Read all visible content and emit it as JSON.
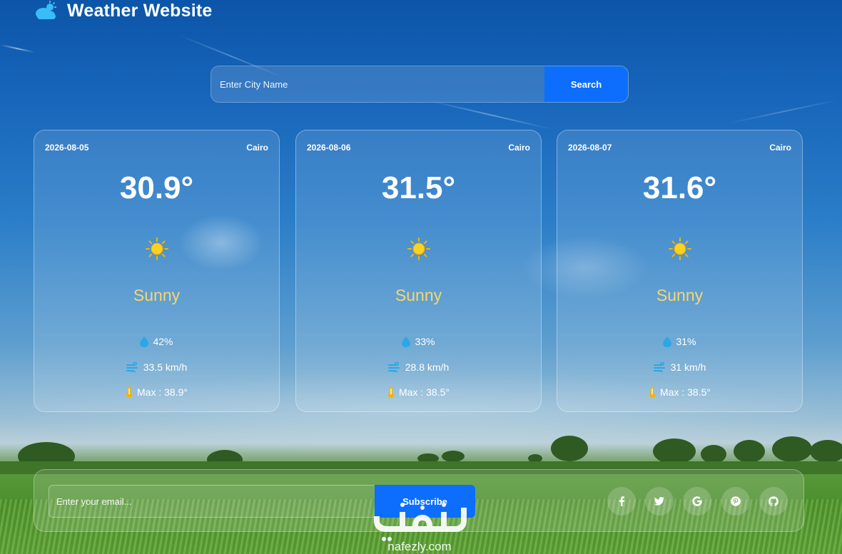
{
  "header": {
    "title": "Weather Website",
    "logo_icon": "cloud-sun-icon"
  },
  "search": {
    "placeholder": "Enter City Name",
    "button_label": "Search"
  },
  "forecast": [
    {
      "date": "2026-08-05",
      "city": "Cairo",
      "temp": "30.9°",
      "condition": "Sunny",
      "condition_icon": "sun-icon",
      "humidity": "42%",
      "wind": "33.5 km/h",
      "max": "Max : 38.9°"
    },
    {
      "date": "2026-08-06",
      "city": "Cairo",
      "temp": "31.5°",
      "condition": "Sunny",
      "condition_icon": "sun-icon",
      "humidity": "33%",
      "wind": "28.8 km/h",
      "max": "Max : 38.5°"
    },
    {
      "date": "2026-08-07",
      "city": "Cairo",
      "temp": "31.6°",
      "condition": "Sunny",
      "condition_icon": "sun-icon",
      "humidity": "31%",
      "wind": "31 km/h",
      "max": "Max : 38.5°"
    }
  ],
  "footer": {
    "email_placeholder": "Enter your email...",
    "subscribe_label": "Subscribe",
    "social": [
      "facebook-icon",
      "twitter-icon",
      "google-icon",
      "pinterest-icon",
      "github-icon"
    ]
  },
  "colors": {
    "accent": "#0d6efd",
    "condition": "#f5d76e"
  }
}
